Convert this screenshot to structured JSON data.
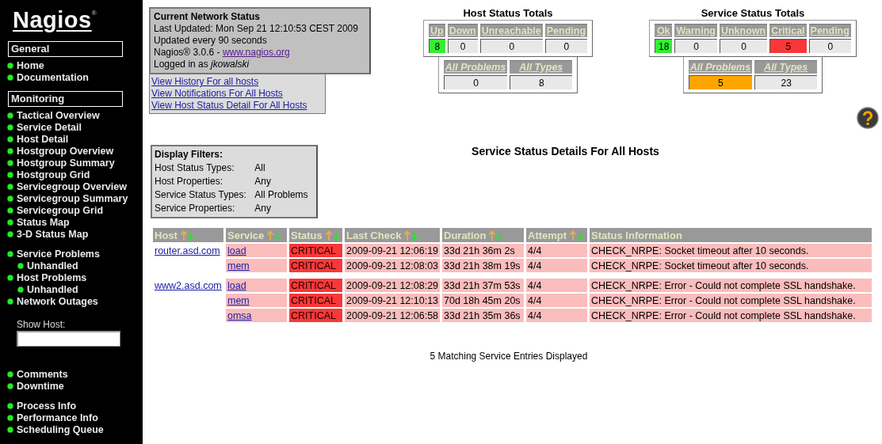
{
  "sidebar": {
    "logo": "Nagios",
    "logo_mark": "®",
    "sections": [
      {
        "heading": "General",
        "items": [
          {
            "label": "Home"
          },
          {
            "label": "Documentation"
          }
        ]
      },
      {
        "heading": "Monitoring",
        "items": [
          {
            "label": "Tactical Overview"
          },
          {
            "label": "Service Detail"
          },
          {
            "label": "Host Detail"
          },
          {
            "label": "Hostgroup Overview"
          },
          {
            "label": "Hostgroup Summary"
          },
          {
            "label": "Hostgroup Grid"
          },
          {
            "label": "Servicegroup Overview"
          },
          {
            "label": "Servicegroup Summary"
          },
          {
            "label": "Servicegroup Grid"
          },
          {
            "label": "Status Map"
          },
          {
            "label": "3-D Status Map"
          }
        ]
      },
      {
        "items": [
          {
            "label": "Service Problems",
            "children": [
              {
                "label": "Unhandled"
              }
            ]
          },
          {
            "label": "Host Problems",
            "children": [
              {
                "label": "Unhandled"
              }
            ]
          },
          {
            "label": "Network Outages"
          }
        ]
      }
    ],
    "show_host": {
      "label": "Show Host:"
    },
    "bottom_sections": [
      {
        "items": [
          {
            "label": "Comments"
          },
          {
            "label": "Downtime"
          }
        ]
      },
      {
        "items": [
          {
            "label": "Process Info"
          },
          {
            "label": "Performance Info"
          },
          {
            "label": "Scheduling Queue"
          }
        ]
      }
    ]
  },
  "status_box": {
    "title": "Current Network Status",
    "lines": [
      "Last Updated: Mon Sep 21 12:10:53 CEST 2009",
      "Updated every 90 seconds"
    ],
    "version": "Nagios® 3.0.6 - ",
    "version_link": "www.nagios.org",
    "login": "Logged in as *jkowalski*"
  },
  "links": [
    "View History For all hosts",
    "View Notifications For All Hosts",
    "View Host Status Detail For All Hosts"
  ],
  "host_totals": {
    "title": "Host Status Totals",
    "counts": [
      {
        "label": "Up",
        "value": "8",
        "color": "#33ee33"
      },
      {
        "label": "Down",
        "value": "0",
        "color": "#e8e8e8"
      },
      {
        "label": "Unreachable",
        "value": "0",
        "color": "#e8e8e8"
      },
      {
        "label": "Pending",
        "value": "0",
        "color": "#e8e8e8"
      }
    ],
    "summary": [
      {
        "label": "All Problems",
        "value": "0",
        "color": "#e8e8e8"
      },
      {
        "label": "All Types",
        "value": "8",
        "color": "#e8e8e8"
      }
    ]
  },
  "service_totals": {
    "title": "Service Status Totals",
    "counts": [
      {
        "label": "Ok",
        "value": "18",
        "color": "#33ee33"
      },
      {
        "label": "Warning",
        "value": "0",
        "color": "#e8e8e8"
      },
      {
        "label": "Unknown",
        "value": "0",
        "color": "#e8e8e8"
      },
      {
        "label": "Critical",
        "value": "5",
        "color": "#f83838"
      },
      {
        "label": "Pending",
        "value": "0",
        "color": "#e8e8e8"
      }
    ],
    "summary": [
      {
        "label": "All Problems",
        "value": "5",
        "color": "#ffa500"
      },
      {
        "label": "All Types",
        "value": "23",
        "color": "#e8e8e8"
      }
    ]
  },
  "filters": {
    "title": "Display Filters:",
    "rows": [
      {
        "label": "Host Status Types:",
        "value": "All"
      },
      {
        "label": "Host Properties:",
        "value": "Any"
      },
      {
        "label": "Service Status Types:",
        "value": "All Problems"
      },
      {
        "label": "Service Properties:",
        "value": "Any"
      }
    ]
  },
  "table": {
    "title": "Service Status Details For All Hosts",
    "columns": [
      {
        "label": "Host",
        "sortable": true
      },
      {
        "label": "Service",
        "sortable": true
      },
      {
        "label": "Status",
        "sortable": true
      },
      {
        "label": "Last Check",
        "sortable": true
      },
      {
        "label": "Duration",
        "sortable": true
      },
      {
        "label": "Attempt",
        "sortable": true
      },
      {
        "label": "Status Information",
        "sortable": false
      }
    ],
    "hosts": [
      {
        "host": "router.asd.com",
        "services": [
          {
            "service": "load",
            "status": "CRITICAL",
            "color": "#f83838",
            "last_check": "2009-09-21 12:06:19",
            "duration": "33d 21h 36m 2s",
            "attempt": "4/4",
            "info": "CHECK_NRPE: Socket timeout after 10 seconds."
          },
          {
            "service": "mem",
            "status": "CRITICAL",
            "color": "#f83838",
            "last_check": "2009-09-21 12:08:03",
            "duration": "33d 21h 38m 19s",
            "attempt": "4/4",
            "info": "CHECK_NRPE: Socket timeout after 10 seconds."
          }
        ]
      },
      {
        "host": "www2.asd.com",
        "services": [
          {
            "service": "load",
            "status": "CRITICAL",
            "color": "#f83838",
            "last_check": "2009-09-21 12:08:29",
            "duration": "33d 21h 37m 53s",
            "attempt": "4/4",
            "info": "CHECK_NRPE: Error - Could not complete SSL handshake."
          },
          {
            "service": "mem",
            "status": "CRITICAL",
            "color": "#f83838",
            "last_check": "2009-09-21 12:10:13",
            "duration": "70d 18h 45m 20s",
            "attempt": "4/4",
            "info": "CHECK_NRPE: Error - Could not complete SSL handshake."
          },
          {
            "service": "omsa",
            "status": "CRITICAL",
            "color": "#f83838",
            "last_check": "2009-09-21 12:06:58",
            "duration": "33d 21h 35m 36s",
            "attempt": "4/4",
            "info": "CHECK_NRPE: Error - Could not complete SSL handshake."
          }
        ]
      }
    ],
    "footer": "5 Matching Service Entries Displayed"
  }
}
